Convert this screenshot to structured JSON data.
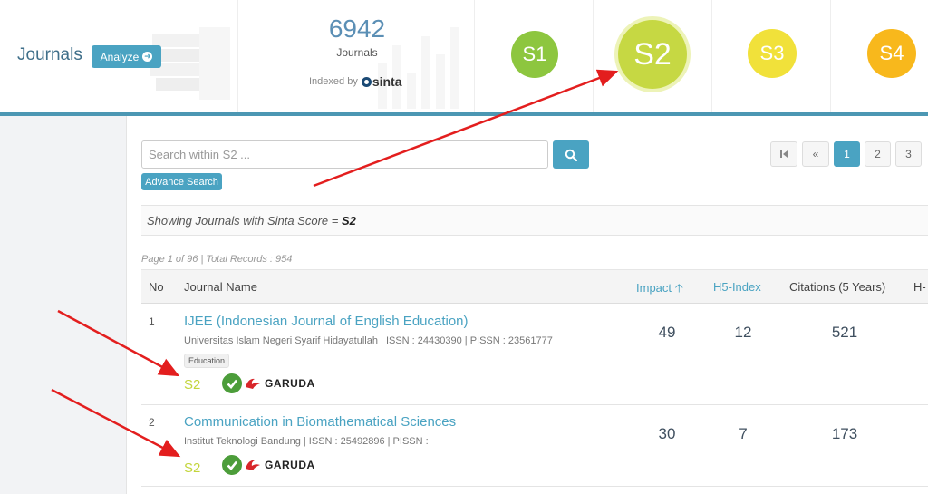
{
  "header": {
    "brand": "Journals",
    "analyze_label": "Analyze",
    "stat": {
      "count": "6942",
      "label": "Journals",
      "indexed_by": "Indexed by",
      "sinta_logo_text": "sinta"
    },
    "scores": [
      {
        "label": "S1",
        "color": "#8dc63f"
      },
      {
        "label": "S2",
        "color": "#c6d843"
      },
      {
        "label": "S3",
        "color": "#f1e13a"
      },
      {
        "label": "S4",
        "color": "#f8b81c"
      }
    ]
  },
  "search": {
    "placeholder": "Search within S2 ...",
    "search_icon": "search-icon",
    "advance_label": "Advance Search"
  },
  "pagination": {
    "first_icon": "first-page-icon",
    "prev_icon": "previous-page-icon",
    "pages": [
      "1",
      "2",
      "3"
    ],
    "active_page": "1"
  },
  "showing": {
    "prefix": "Showing Journals with Sinta Score = ",
    "value": "S2"
  },
  "page_info": "Page 1 of 96 | Total Records : 954",
  "table": {
    "headers": {
      "no": "No",
      "name": "Journal Name",
      "impact": "Impact",
      "h5": "H5-Index",
      "citations": "Citations (5 Years)",
      "h": "H-"
    },
    "rows": [
      {
        "no": "1",
        "title": "IJEE (Indonesian Journal of English Education)",
        "meta": "Universitas Islam Negeri Syarif Hidayatullah | ISSN : 24430390 | PISSN : 23561777",
        "tag": "Education",
        "score": "S2",
        "garuda": "GARUDA",
        "impact": "49",
        "h5": "12",
        "citations": "521"
      },
      {
        "no": "2",
        "title": "Communication in Biomathematical Sciences",
        "meta": "Institut Teknologi Bandung | ISSN : 25492896 | PISSN :",
        "score": "S2",
        "garuda": "GARUDA",
        "impact": "30",
        "h5": "7",
        "citations": "173"
      }
    ]
  },
  "colors": {
    "accent": "#4aa3c2",
    "header_rule": "#4c97b3",
    "annotation": "#e31e1e"
  }
}
